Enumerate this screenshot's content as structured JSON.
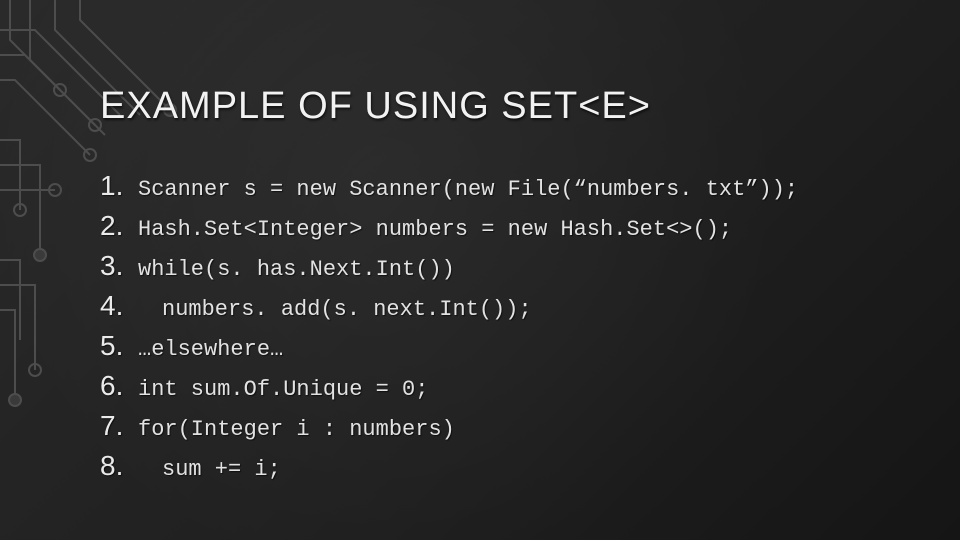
{
  "title": "EXAMPLE OF USING SET<E>",
  "code": {
    "lines": [
      {
        "n": "1.",
        "text": "Scanner s = new Scanner(new File(“numbers. txt”));",
        "indent": false
      },
      {
        "n": "2.",
        "text": "Hash.Set<Integer> numbers = new Hash.Set<>();",
        "indent": false
      },
      {
        "n": "3.",
        "text": "while(s. has.Next.Int())",
        "indent": false
      },
      {
        "n": "4.",
        "text": "numbers. add(s. next.Int());",
        "indent": true
      },
      {
        "n": "5.",
        "text": "…elsewhere…",
        "indent": false
      },
      {
        "n": "6.",
        "text": "int sum.Of.Unique = 0;",
        "indent": false
      },
      {
        "n": "7.",
        "text": "for(Integer i : numbers)",
        "indent": false
      },
      {
        "n": "8.",
        "text": "sum += i;",
        "indent": true
      }
    ]
  }
}
